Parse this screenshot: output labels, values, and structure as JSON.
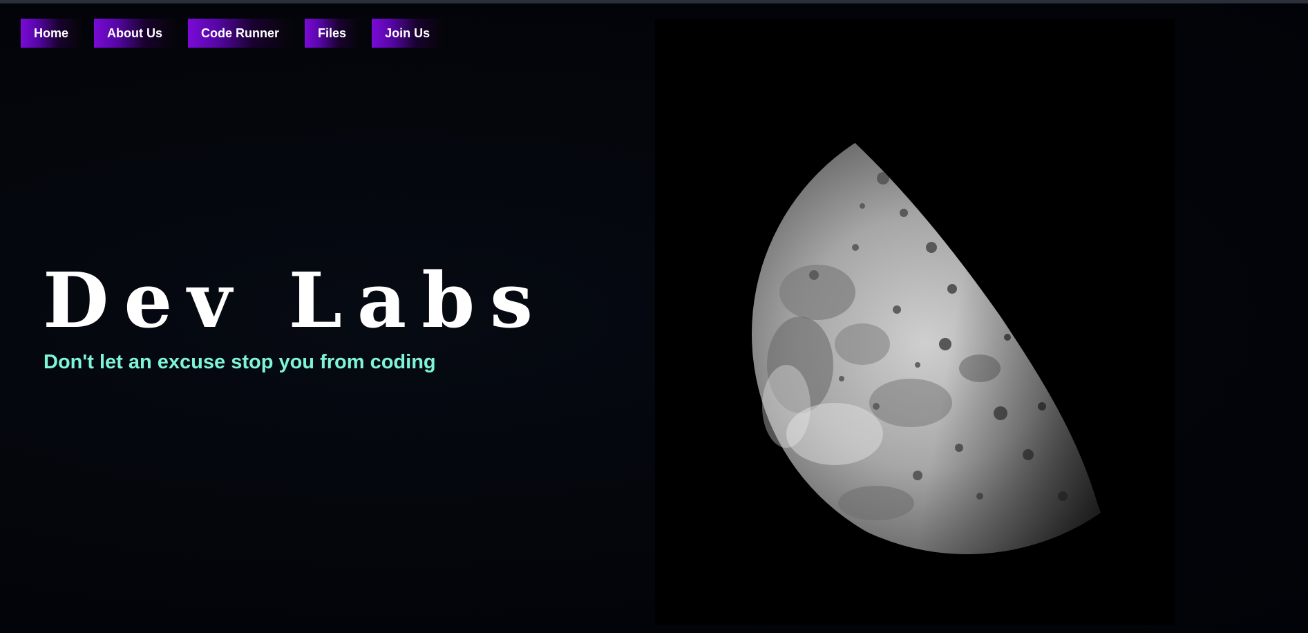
{
  "nav": {
    "items": [
      {
        "label": "Home"
      },
      {
        "label": "About Us"
      },
      {
        "label": "Code Runner"
      },
      {
        "label": "Files"
      },
      {
        "label": "Join Us"
      }
    ]
  },
  "hero": {
    "title": "Dev Labs",
    "subtitle": "Don't let an excuse stop you from coding"
  },
  "image": {
    "subject": "half-moon-photo"
  },
  "colors": {
    "background": "#03050a",
    "nav_accent": "#7a0bd6",
    "subtitle": "#7ff5d8",
    "title": "#ffffff"
  }
}
